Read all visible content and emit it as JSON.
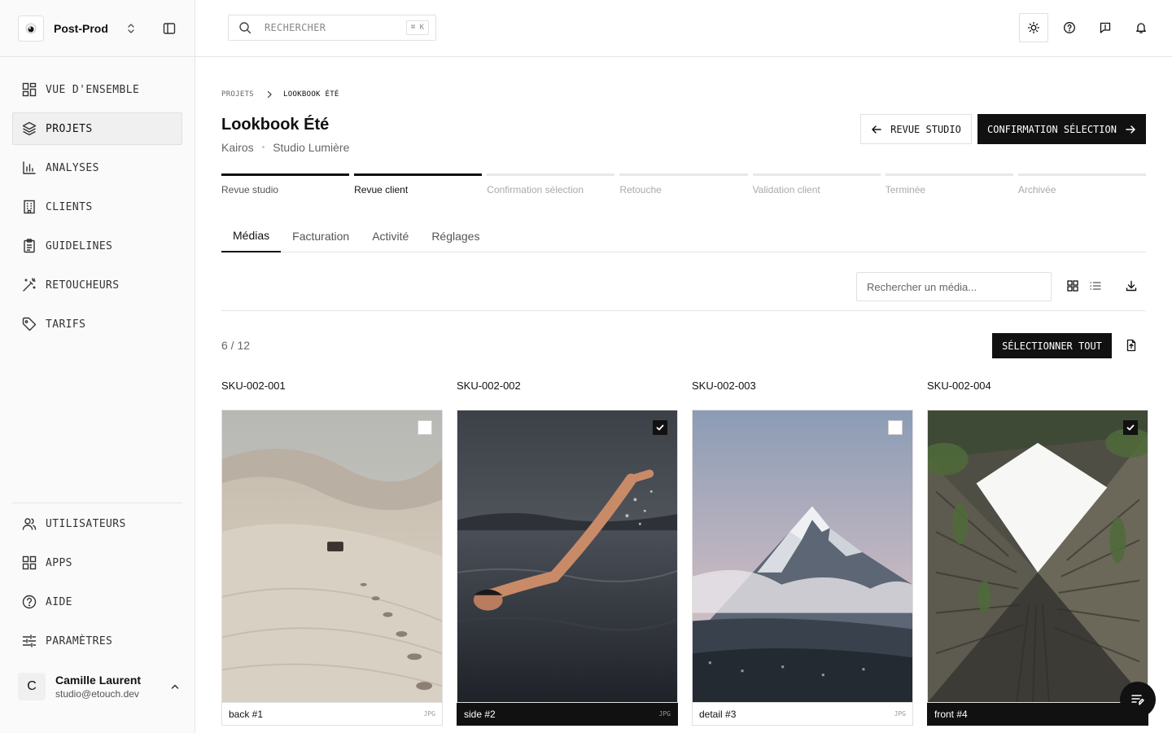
{
  "brand": {
    "name": "Post-Prod"
  },
  "nav": {
    "items": [
      {
        "label": "VUE D'ENSEMBLE",
        "icon": "dashboard-icon"
      },
      {
        "label": "PROJETS",
        "icon": "layers-icon",
        "active": true
      },
      {
        "label": "ANALYSES",
        "icon": "bar-chart-icon"
      },
      {
        "label": "CLIENTS",
        "icon": "building-icon"
      },
      {
        "label": "GUIDELINES",
        "icon": "clipboard-icon"
      },
      {
        "label": "RETOUCHEURS",
        "icon": "magic-wand-icon"
      },
      {
        "label": "TARIFS",
        "icon": "tag-icon"
      }
    ],
    "bottom_items": [
      {
        "label": "UTILISATEURS",
        "icon": "users-icon"
      },
      {
        "label": "APPS",
        "icon": "apps-icon"
      },
      {
        "label": "AIDE",
        "icon": "help-icon"
      },
      {
        "label": "PARAMÈTRES",
        "icon": "sliders-icon"
      }
    ]
  },
  "user": {
    "initial": "C",
    "name": "Camille Laurent",
    "email": "studio@etouch.dev"
  },
  "topbar": {
    "search_placeholder": "RECHERCHER",
    "shortcut": "⌘ K"
  },
  "breadcrumb": {
    "parent": "PROJETS",
    "current": "LOOKBOOK ÉTÉ"
  },
  "project": {
    "title": "Lookbook Été",
    "client": "Kairos",
    "studio": "Studio Lumière"
  },
  "actions": {
    "back_label": "REVUE STUDIO",
    "next_label": "CONFIRMATION SÉLECTION"
  },
  "steps": [
    {
      "label": "Revue studio",
      "state": "done"
    },
    {
      "label": "Revue client",
      "state": "current"
    },
    {
      "label": "Confirmation sélection",
      "state": "todo"
    },
    {
      "label": "Retouche",
      "state": "todo"
    },
    {
      "label": "Validation client",
      "state": "todo"
    },
    {
      "label": "Terminée",
      "state": "todo"
    },
    {
      "label": "Archivée",
      "state": "todo"
    }
  ],
  "tabs": [
    {
      "label": "Médias",
      "active": true
    },
    {
      "label": "Facturation"
    },
    {
      "label": "Activité"
    },
    {
      "label": "Réglages"
    }
  ],
  "media": {
    "search_placeholder": "Rechercher un média...",
    "count": "6 / 12",
    "select_all_label": "SÉLECTIONNER TOUT",
    "items": [
      {
        "sku": "SKU-002-001",
        "name": "back #1",
        "type": "JPG",
        "selected": false
      },
      {
        "sku": "SKU-002-002",
        "name": "side #2",
        "type": "JPG",
        "selected": true
      },
      {
        "sku": "SKU-002-003",
        "name": "detail #3",
        "type": "JPG",
        "selected": false
      },
      {
        "sku": "SKU-002-004",
        "name": "front #4",
        "type": "JPG",
        "selected": true
      }
    ]
  }
}
